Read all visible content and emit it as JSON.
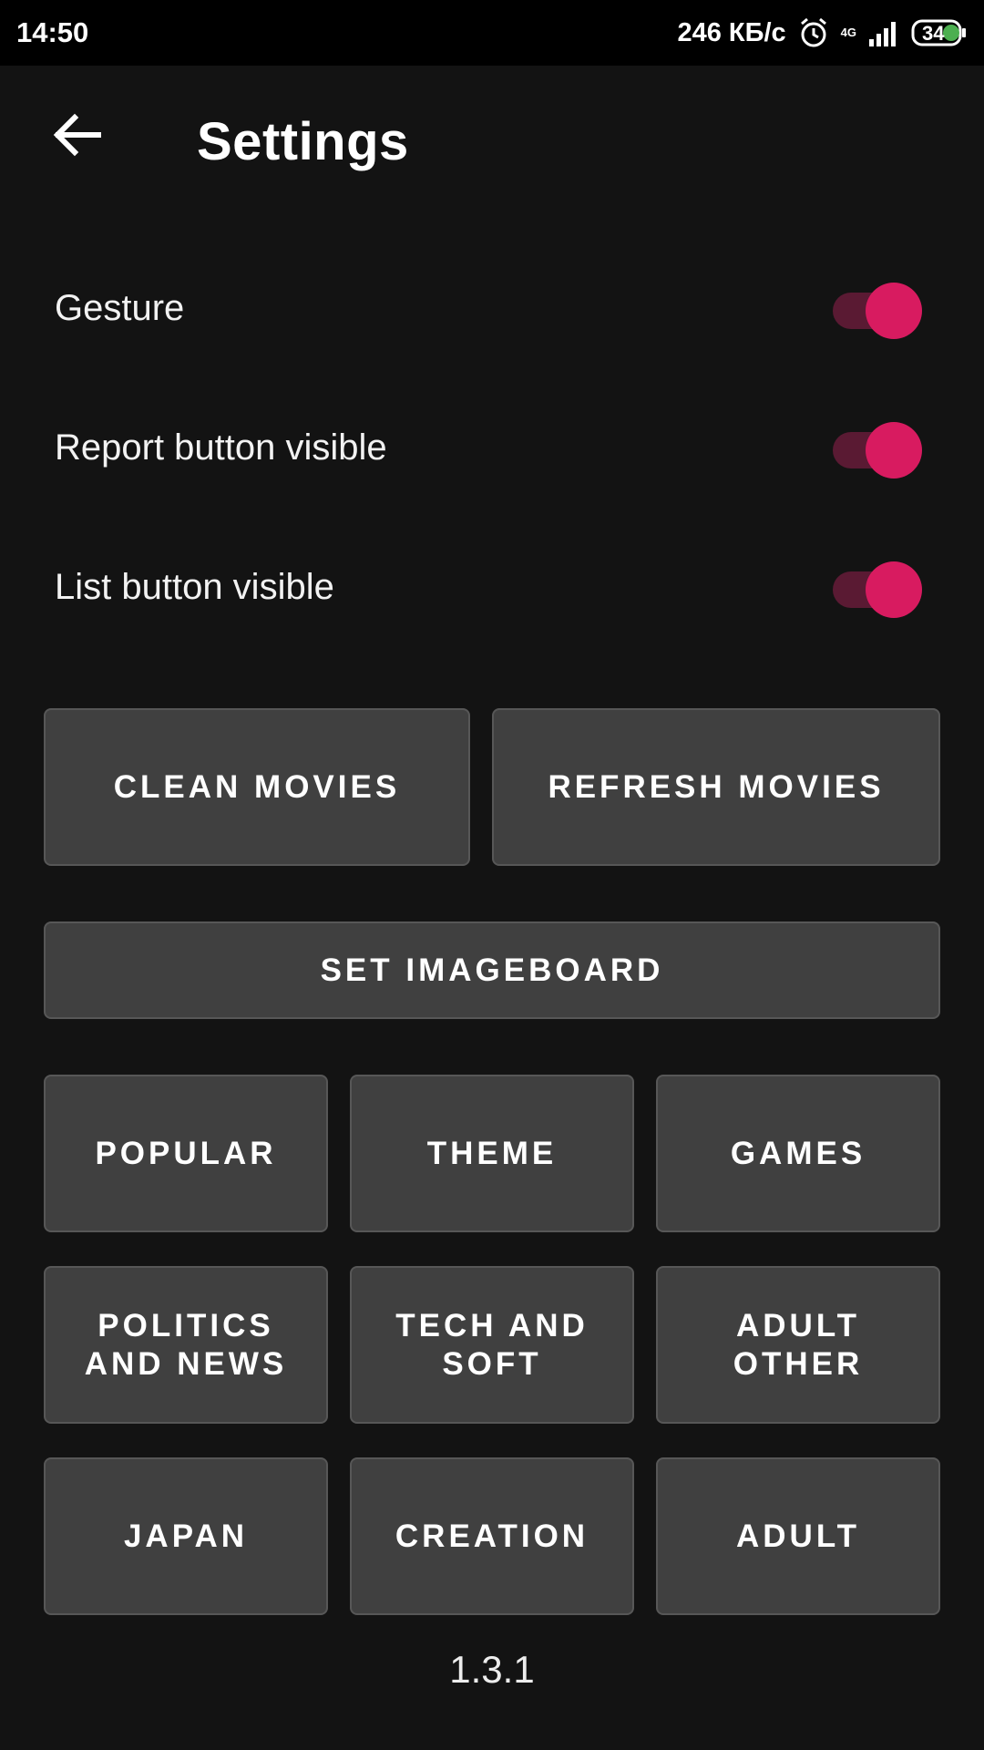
{
  "status_bar": {
    "time": "14:50",
    "network_speed": "246 КБ/с",
    "network_type": "4G",
    "battery": "34",
    "icons": [
      "alarm-icon",
      "signal-icon",
      "battery-icon"
    ]
  },
  "app_bar": {
    "title": "Settings",
    "back_icon": "arrow-left-icon"
  },
  "settings": [
    {
      "label": "Gesture",
      "enabled": true
    },
    {
      "label": "Report button visible",
      "enabled": true
    },
    {
      "label": "List button visible",
      "enabled": true
    }
  ],
  "actions": {
    "clean": "CLEAN MOVIES",
    "refresh": "REFRESH MOVIES",
    "imageboard": "SET IMAGEBOARD"
  },
  "categories": [
    "POPULAR",
    "THEME",
    "GAMES",
    "POLITICS\nAND NEWS",
    "TECH AND\nSOFT",
    "ADULT\nOTHER",
    "JAPAN",
    "CREATION",
    "ADULT"
  ],
  "version": "1.3.1",
  "colors": {
    "background": "#131313",
    "button": "#404040",
    "accent": "#d81b60",
    "track": "#5a1a33"
  }
}
